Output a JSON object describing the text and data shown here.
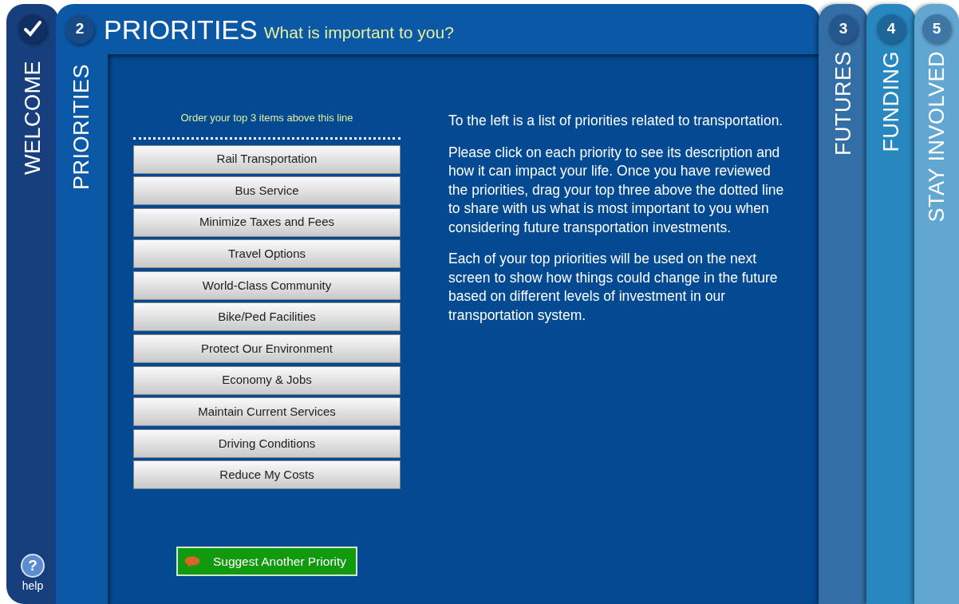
{
  "steps": [
    {
      "label": "WELCOME",
      "kind": "done"
    },
    {
      "number": "2",
      "label": "PRIORITIES",
      "kind": "current"
    },
    {
      "number": "3",
      "label": "FUTURES",
      "kind": "upcoming"
    },
    {
      "number": "4",
      "label": "FUNDING",
      "kind": "upcoming"
    },
    {
      "number": "5",
      "label": "STAY INVOLVED",
      "kind": "upcoming"
    }
  ],
  "header": {
    "title": "PRIORITIES",
    "subtitle": "What is important to you?"
  },
  "priority_list": {
    "hint": "Order your top 3 items above this line",
    "items": [
      "Rail Transportation",
      "Bus Service",
      "Minimize Taxes and Fees",
      "Travel Options",
      "World-Class Community",
      "Bike/Ped Facilities",
      "Protect Our Environment",
      "Economy & Jobs",
      "Maintain Current Services",
      "Driving Conditions",
      "Reduce My Costs"
    ],
    "suggest_button": "Suggest Another Priority"
  },
  "instructions": [
    "To the left is a list of priorities related to transportation.",
    "Please click on each priority to see its description and how it can impact your life. Once you have reviewed the priorities, drag your top three above the dotted line to share with us what is most important to you when considering future transportation investments.",
    "Each of your top priorities will be used on the next screen to show how things could change in the future based on different levels of investment in our transportation system."
  ],
  "help": {
    "icon": "?",
    "label": "help"
  }
}
